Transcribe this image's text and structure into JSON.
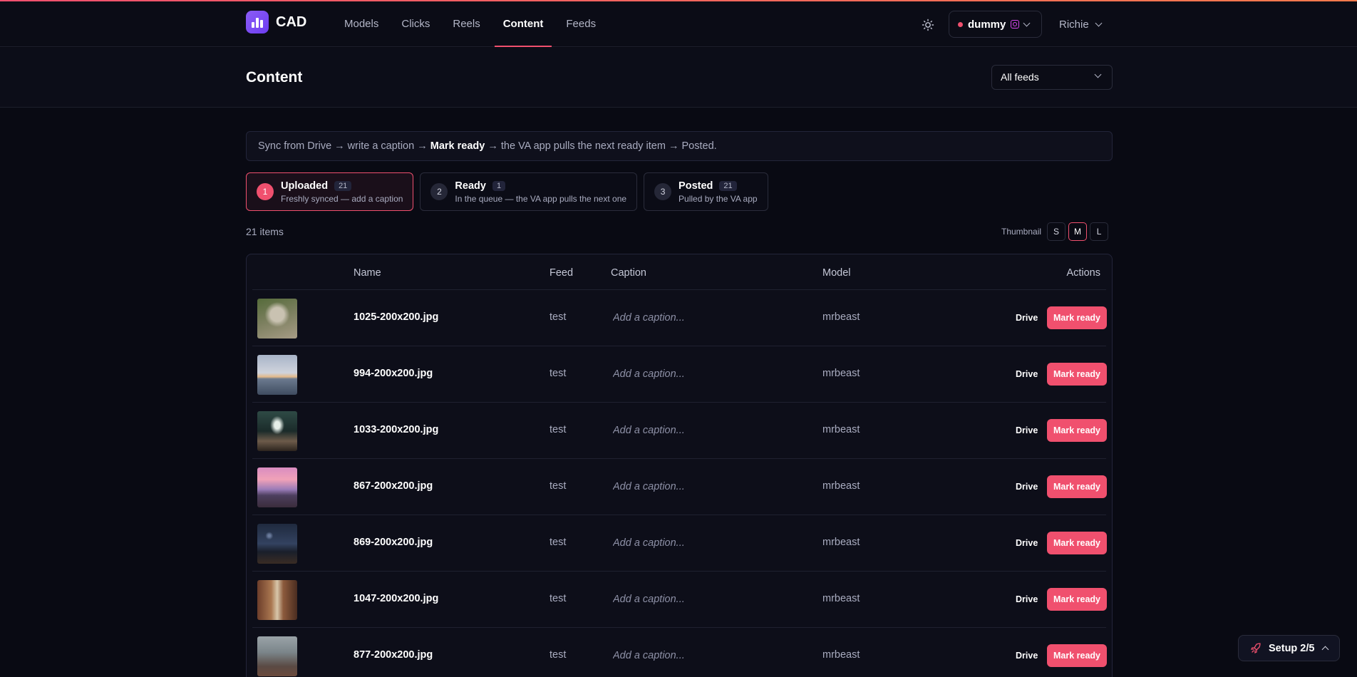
{
  "app": {
    "name": "CAD"
  },
  "nav": {
    "links": [
      "Models",
      "Clicks",
      "Reels",
      "Content",
      "Feeds"
    ],
    "active": "Content",
    "account": "dummy",
    "user": "Richie"
  },
  "page": {
    "title": "Content",
    "feed_filter": "All feeds",
    "info": {
      "before": "Sync from Drive → write a caption → ",
      "bold": "Mark ready",
      "after": " → the VA app pulls the next ready item → Posted."
    }
  },
  "steps": [
    {
      "num": "1",
      "title": "Uploaded",
      "count": "21",
      "sub": "Freshly synced — add a caption",
      "active": true
    },
    {
      "num": "2",
      "title": "Ready",
      "count": "1",
      "sub": "In the queue — the VA app pulls the next one",
      "active": false
    },
    {
      "num": "3",
      "title": "Posted",
      "count": "21",
      "sub": "Pulled by the VA app",
      "active": false
    }
  ],
  "list": {
    "items_count": "21 items",
    "thumbnail_label": "Thumbnail",
    "sizes": [
      "S",
      "M",
      "L"
    ],
    "active_size": "M"
  },
  "table": {
    "headers": {
      "name": "Name",
      "feed": "Feed",
      "caption": "Caption",
      "model": "Model",
      "actions": "Actions"
    },
    "caption_placeholder": "Add a caption...",
    "drive_label": "Drive",
    "mark_label": "Mark ready",
    "rows": [
      {
        "name": "1025-200x200.jpg",
        "feed": "test",
        "model": "mrbeast",
        "thumb": "dog-blanket"
      },
      {
        "name": "994-200x200.jpg",
        "feed": "test",
        "model": "mrbeast",
        "thumb": "sea-sunset"
      },
      {
        "name": "1033-200x200.jpg",
        "feed": "test",
        "model": "mrbeast",
        "thumb": "railway-tunnel"
      },
      {
        "name": "867-200x200.jpg",
        "feed": "test",
        "model": "mrbeast",
        "thumb": "pier-pink-sky"
      },
      {
        "name": "869-200x200.jpg",
        "feed": "test",
        "model": "mrbeast",
        "thumb": "night-sky-lake"
      },
      {
        "name": "1047-200x200.jpg",
        "feed": "test",
        "model": "mrbeast",
        "thumb": "city-street"
      },
      {
        "name": "877-200x200.jpg",
        "feed": "test",
        "model": "mrbeast",
        "thumb": "misty-forest"
      }
    ]
  },
  "setup": {
    "label": "Setup 2/5"
  },
  "colors": {
    "accent": "#f0506e",
    "background": "#090a13",
    "brand": "#8b5cf6"
  }
}
